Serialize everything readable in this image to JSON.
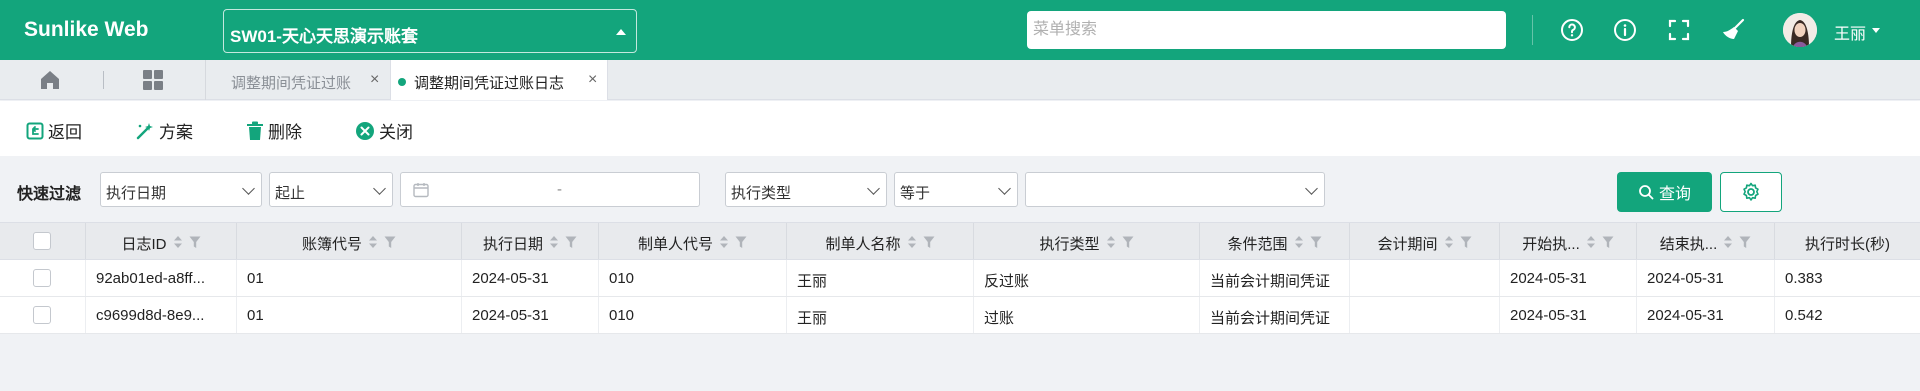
{
  "app": {
    "logo": "Sunlike Web",
    "account": "SW01-天心天思演示账套",
    "search_placeholder": "菜单搜索",
    "user_name": "王丽"
  },
  "colors": {
    "primary": "#13a57c",
    "header_bg": "#13a57c"
  },
  "header_icons": [
    "help-icon",
    "info-icon",
    "fullscreen-icon",
    "broom-icon"
  ],
  "tabs": [
    {
      "label": "调整期间凭证过账",
      "active": false
    },
    {
      "label": "调整期间凭证过账日志",
      "active": true
    }
  ],
  "toolbar": {
    "back": "返回",
    "scheme": "方案",
    "delete": "删除",
    "close": "关闭"
  },
  "filter": {
    "label": "快速过滤",
    "field1": "执行日期",
    "op1": "起止",
    "date_sep": "-",
    "field2": "执行类型",
    "op2": "等于",
    "value2": "",
    "query": "查询"
  },
  "table": {
    "columns": [
      "日志ID",
      "账簿代号",
      "执行日期",
      "制单人代号",
      "制单人名称",
      "执行类型",
      "条件范围",
      "会计期间",
      "开始执...",
      "结束执...",
      "执行时长(秒)"
    ],
    "rows": [
      [
        "92ab01ed-a8ff...",
        "01",
        "2024-05-31",
        "010",
        "王丽",
        "反过账",
        "当前会计期间凭证",
        "",
        "2024-05-31",
        "2024-05-31",
        "0.383"
      ],
      [
        "c9699d8d-8e9...",
        "01",
        "2024-05-31",
        "010",
        "王丽",
        "过账",
        "当前会计期间凭证",
        "",
        "2024-05-31",
        "2024-05-31",
        "0.542"
      ]
    ]
  }
}
